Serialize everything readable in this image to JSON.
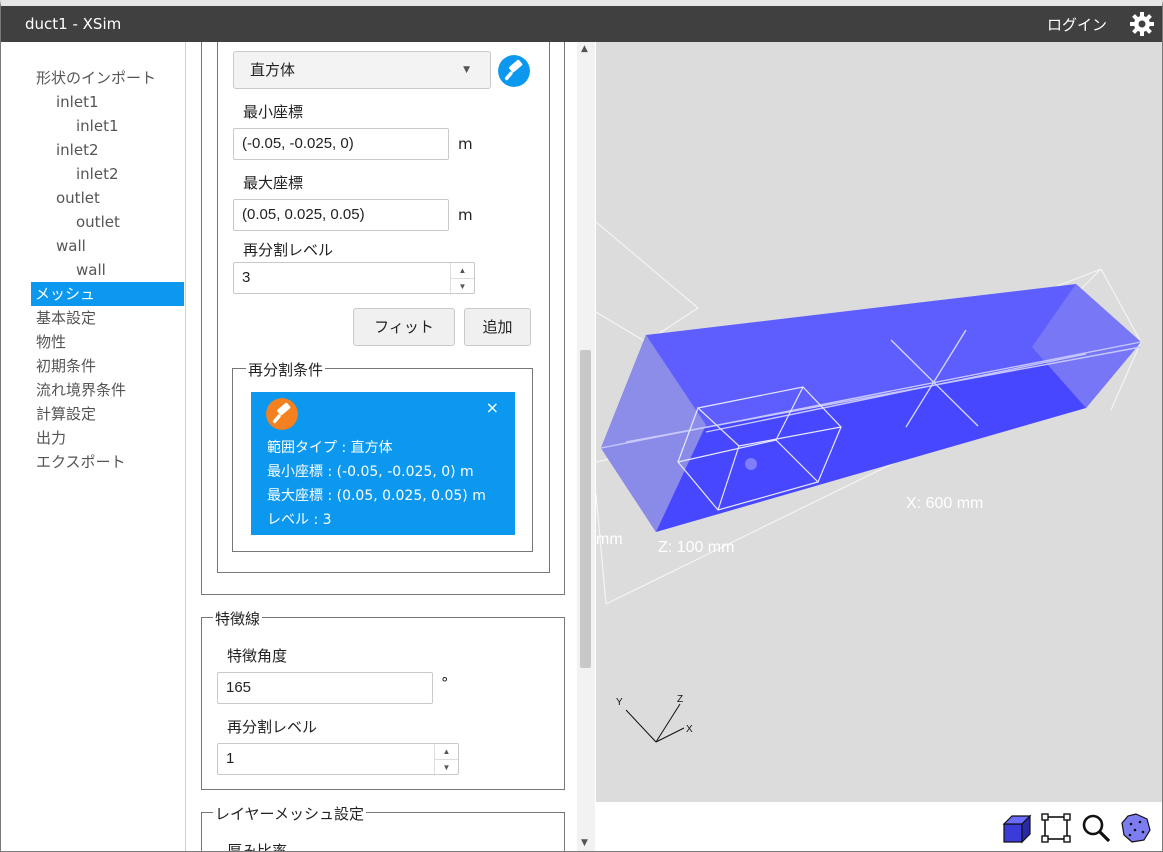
{
  "window": {
    "title": "duct1 - XSim",
    "login_label": "ログイン",
    "settings_icon": "gear-icon"
  },
  "sidebar": {
    "items": [
      {
        "label": "形状のインポート",
        "level": 0
      },
      {
        "label": "inlet1",
        "level": 1
      },
      {
        "label": "inlet1",
        "level": 2
      },
      {
        "label": "inlet2",
        "level": 1
      },
      {
        "label": "inlet2",
        "level": 2
      },
      {
        "label": "outlet",
        "level": 1
      },
      {
        "label": "outlet",
        "level": 2
      },
      {
        "label": "wall",
        "level": 1
      },
      {
        "label": "wall",
        "level": 2
      },
      {
        "label": "メッシュ",
        "level": 0,
        "selected": true
      },
      {
        "label": "基本設定",
        "level": 0
      },
      {
        "label": "物性",
        "level": 0
      },
      {
        "label": "初期条件",
        "level": 0
      },
      {
        "label": "流れ境界条件",
        "level": 0
      },
      {
        "label": "計算設定",
        "level": 0
      },
      {
        "label": "出力",
        "level": 0
      },
      {
        "label": "エクスポート",
        "level": 0
      }
    ]
  },
  "refinement": {
    "range_type_value": "直方体",
    "min_label": "最小座標",
    "min_value": "(-0.05, -0.025, 0)",
    "min_unit": "m",
    "max_label": "最大座標",
    "max_value": "(0.05, 0.025, 0.05)",
    "max_unit": "m",
    "level_label": "再分割レベル",
    "level_value": "3",
    "fit_button": "フィット",
    "add_button": "追加",
    "conditions_legend": "再分割条件",
    "card": {
      "close": "×",
      "lines": [
        "範囲タイプ : 直方体",
        "最小座標 : (-0.05, -0.025, 0) m",
        "最大座標 : (0.05, 0.025, 0.05) m",
        "レベル : 3"
      ]
    }
  },
  "feature_lines": {
    "legend": "特徴線",
    "angle_label": "特徴角度",
    "angle_value": "165",
    "angle_unit": "°",
    "level_label": "再分割レベル",
    "level_value": "1"
  },
  "layer_mesh": {
    "legend": "レイヤーメッシュ設定",
    "thickness_label": "厚み比率"
  },
  "viewport": {
    "x_dim": "X: 600 mm",
    "z_dim": "Z: 100 mm",
    "y_dim_partial": "mm",
    "axes": {
      "x": "X",
      "y": "Y",
      "z": "Z"
    }
  },
  "toolbar": {
    "icons": [
      "box-view-icon",
      "fit-frame-icon",
      "zoom-icon",
      "sphere-view-icon"
    ]
  },
  "colors": {
    "accent": "#0b98ee",
    "titlebar": "#404040",
    "mesh_fill": "#4b4bff",
    "orange": "#f4801f"
  }
}
